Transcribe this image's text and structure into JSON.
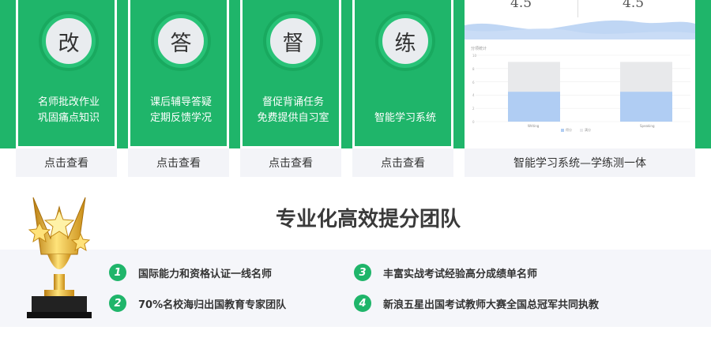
{
  "features": [
    {
      "char": "改",
      "lines": [
        "名师批改作业",
        "巩固痛点知识"
      ],
      "link": "点击查看"
    },
    {
      "char": "答",
      "lines": [
        "课后辅导答疑",
        "定期反馈学况"
      ],
      "link": "点击查看"
    },
    {
      "char": "督",
      "lines": [
        "督促背诵任务",
        "免费提供自习室"
      ],
      "link": "点击查看"
    },
    {
      "char": "练",
      "lines": [
        "智能学习系统"
      ],
      "link": "点击查看"
    }
  ],
  "system": {
    "scores": [
      "4.5",
      "4.5"
    ],
    "caption": "智能学习系统—学练测一体",
    "chart_title": "分项统计",
    "categories": [
      "Writing",
      "Speaking"
    ],
    "legend": [
      "得分",
      "满分"
    ],
    "yticks": [
      "10",
      "8",
      "6",
      "4",
      "2",
      "0"
    ],
    "values": [
      4.5,
      4.5
    ],
    "max": [
      9,
      9
    ],
    "ylim": [
      0,
      10
    ],
    "colors": {
      "score": "#b0cdf3",
      "full": "#e8e9eb"
    }
  },
  "team": {
    "title": "专业化高效提分团队",
    "items": [
      {
        "num": "1",
        "text": "国际能力和资格认证一线名师"
      },
      {
        "num": "2",
        "text": "70%名校海归出国教育专家团队"
      },
      {
        "num": "3",
        "text": "丰富实战考试经验高分成绩单名师"
      },
      {
        "num": "4",
        "text": "新浪五星出国考试教师大赛全国总冠军共同执教"
      }
    ]
  },
  "colors": {
    "brand_green": "#1fb56a",
    "footer_bg": "#f3f4f8",
    "band_bg": "#f5f6fa"
  },
  "icons": {
    "trophy": "trophy-icon"
  }
}
